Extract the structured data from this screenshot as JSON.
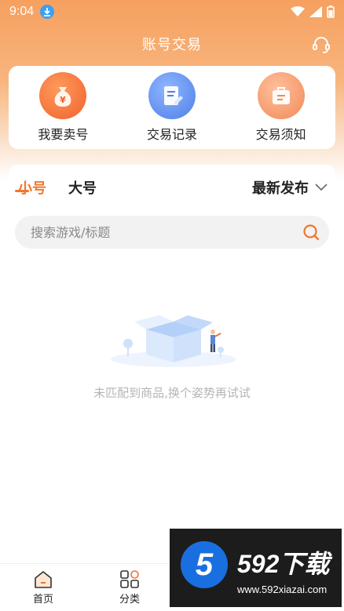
{
  "status_bar": {
    "time": "9:04"
  },
  "header": {
    "title": "账号交易"
  },
  "quick_actions": [
    {
      "label": "我要卖号",
      "icon": "money-bag-icon"
    },
    {
      "label": "交易记录",
      "icon": "document-edit-icon"
    },
    {
      "label": "交易须知",
      "icon": "briefcase-icon"
    }
  ],
  "tabs": [
    {
      "label": "小号",
      "active": true
    },
    {
      "label": "大号",
      "active": false
    }
  ],
  "sort": {
    "selected": "最新发布"
  },
  "search": {
    "placeholder": "搜索游戏/标题"
  },
  "empty_state": {
    "message": "未匹配到商品,换个姿势再试试"
  },
  "bottom_nav": [
    {
      "label": "首页",
      "icon": "home-icon"
    },
    {
      "label": "分类",
      "icon": "grid-icon"
    }
  ],
  "watermark": {
    "brand": "592下载",
    "url": "www.592xiazai.com"
  },
  "colors": {
    "accent": "#f0762e",
    "header_top": "#f6a05f"
  }
}
